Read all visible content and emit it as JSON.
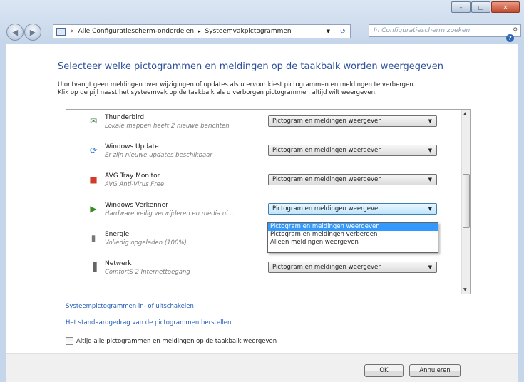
{
  "breadcrumb": {
    "prefix": "«",
    "segment1": "Alle Configuratiescherm-onderdelen",
    "separator": "▸",
    "segment2": "Systeemvakpictogrammen"
  },
  "search": {
    "placeholder": "In Configuratiescherm zoeken"
  },
  "heading": "Selecteer welke pictogrammen en meldingen op de taakbalk worden weergegeven",
  "intro": {
    "line1": "U ontvangt geen meldingen over wijzigingen of updates als u ervoor kiest pictogrammen en meldingen te verbergen.",
    "line2": "Klik op de pijl naast het systeemvak op de taakbalk als u verborgen pictogrammen altijd wilt weergeven."
  },
  "items": [
    {
      "name": "Thunderbird",
      "desc": "Lokale mappen heeft 2 nieuwe berichten",
      "behavior": "Pictogram en meldingen weergeven",
      "icon": "thunderbird-icon",
      "glyph": "✉",
      "color": "#3a7c3a"
    },
    {
      "name": "Windows Update",
      "desc": "Er zijn nieuwe updates beschikbaar",
      "behavior": "Pictogram en meldingen weergeven",
      "icon": "windows-update-icon",
      "glyph": "⟳",
      "color": "#2a6fd6"
    },
    {
      "name": "AVG Tray Monitor",
      "desc": "AVG Anti-Virus Free",
      "behavior": "Pictogram en meldingen weergeven",
      "icon": "avg-icon",
      "glyph": "■",
      "color": "#d23b2a"
    },
    {
      "name": "Windows Verkenner",
      "desc": "Hardware veilig verwijderen en media ui...",
      "behavior": "Pictogram en meldingen weergeven",
      "icon": "safely-remove-hardware-icon",
      "glyph": "▶",
      "color": "#3a8a2a"
    },
    {
      "name": "Energie",
      "desc": "Volledig opgeladen (100%)",
      "behavior": "",
      "icon": "battery-icon",
      "glyph": "▮",
      "color": "#777777"
    },
    {
      "name": "Netwerk",
      "desc": "ComfortS  2 Internettoegang",
      "behavior": "Pictogram en meldingen weergeven",
      "icon": "network-icon",
      "glyph": "▐",
      "color": "#666666"
    }
  ],
  "dropdown_options": [
    "Pictogram en meldingen weergeven",
    "Pictogram en meldingen verbergen",
    "Alleen meldingen weergeven"
  ],
  "links": {
    "system_icons": "Systeempictogrammen in- of uitschakelen",
    "restore_default": "Het standaardgedrag van de pictogrammen herstellen"
  },
  "always_show_label": "Altijd alle pictogrammen en meldingen op de taakbalk weergeven",
  "buttons": {
    "ok": "OK",
    "cancel": "Annuleren"
  },
  "window_buttons": {
    "minimize": "–",
    "maximize": "□",
    "close": "✕"
  }
}
